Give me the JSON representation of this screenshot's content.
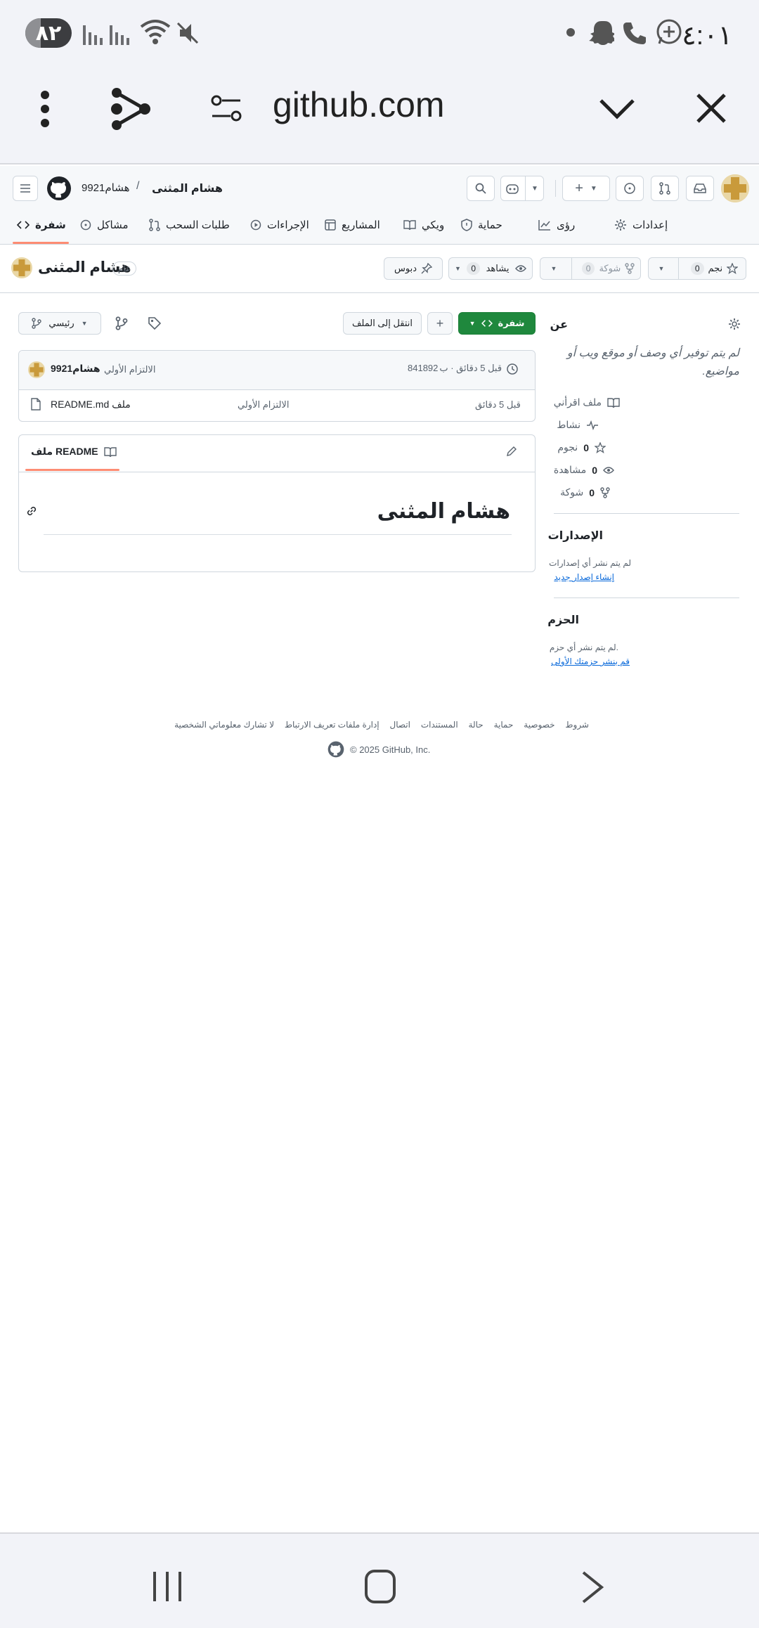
{
  "status_bar": {
    "battery": "٨٢",
    "time": "٤:٠١"
  },
  "browser": {
    "url": "github.com"
  },
  "header": {
    "user": "هشام9921",
    "separator": "/",
    "repo": "هشام المثنى"
  },
  "tabs": [
    {
      "label": "شفرة",
      "icon": "code-icon"
    },
    {
      "label": "مشاكل",
      "icon": "issue-icon"
    },
    {
      "label": "طلبات السحب",
      "icon": "pull-request-icon"
    },
    {
      "label": "الإجراءات",
      "icon": "play-icon"
    },
    {
      "label": "المشاريع",
      "icon": "table-icon"
    },
    {
      "label": "ويكي",
      "icon": "book-icon"
    },
    {
      "label": "حماية",
      "icon": "shield-icon"
    },
    {
      "label": "رؤى",
      "icon": "graph-icon"
    },
    {
      "label": "إعدادات",
      "icon": "gear-icon"
    }
  ],
  "repo": {
    "name": "هشام المثنى",
    "visibility": "عام",
    "pin_label": "دبوس",
    "watch_label": "يشاهد",
    "watch_count": "0",
    "fork_label": "شوكة",
    "fork_count": "0",
    "star_label": "نجم",
    "star_count": "0"
  },
  "toolbar": {
    "branch": "رئيسي",
    "goto_file": "انتقل إلى الملف",
    "add": "+",
    "code_button": "شفرة"
  },
  "commit": {
    "author": "هشام9921",
    "message": "الالتزام الأولي",
    "hash": "841892",
    "time": "قبل 5 دقائق · ب"
  },
  "files": [
    {
      "name": "README.md ملف",
      "message": "الالتزام الأولي",
      "time": "قبل 5 دقائق"
    }
  ],
  "readme": {
    "tab_label": "README ملف",
    "heading": "هشام المثنى"
  },
  "about": {
    "title": "عن",
    "description": "لم يتم توفير أي وصف أو موقع ويب أو مواضيع.",
    "readme_label": "ملف اقرأني",
    "activity_label": "نشاط",
    "stars_label": "نجوم",
    "stars": "0",
    "watching_label": "مشاهدة",
    "watching": "0",
    "forks_label": "شوكة",
    "forks": "0"
  },
  "releases": {
    "title": "الإصدارات",
    "empty": "لم يتم نشر أي إصدارات",
    "link": "إنشاء إصدار جديد"
  },
  "packages": {
    "title": "الحزم",
    "empty": "لم يتم نشر أي حزم.",
    "link": "قم بنشر حزمتك الأولى"
  },
  "footer": {
    "links": [
      "شروط",
      "خصوصية",
      "حماية",
      "حالة",
      "المستندات",
      "اتصال",
      "إدارة ملفات تعريف الارتباط",
      "لا تشارك معلوماتي الشخصية"
    ],
    "copyright": "© 2025 GitHub, Inc."
  },
  "colors": {
    "accent_green": "#1f883d",
    "link_blue": "#0969da",
    "tab_underline": "#fd8c73"
  }
}
